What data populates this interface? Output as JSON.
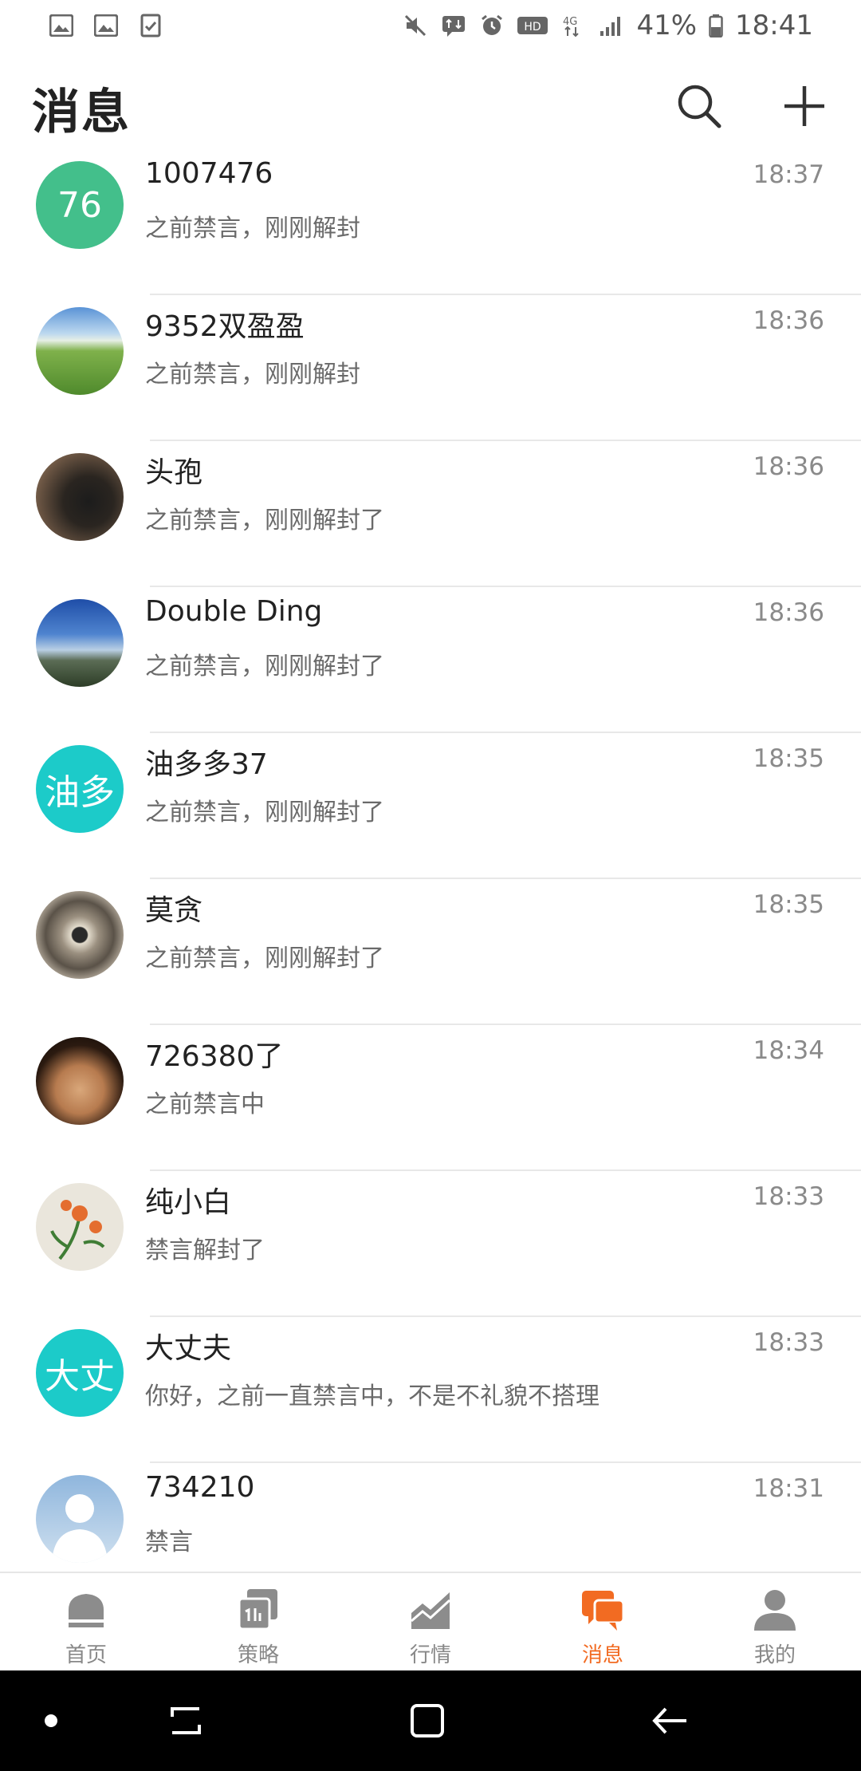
{
  "status_bar": {
    "left_icons": [
      "image-icon",
      "image-icon",
      "checklist-icon"
    ],
    "right_icons": [
      "mute-icon",
      "data-transfer-icon",
      "alarm-icon",
      "hd-icon",
      "network-4g-icon",
      "signal-icon"
    ],
    "battery": "41%",
    "time": "18:41"
  },
  "header": {
    "title": "消息",
    "search_icon": "search-icon",
    "add_icon": "plus-icon"
  },
  "conversations": [
    {
      "name": "1007476",
      "time": "18:37",
      "preview": "之前禁言，刚刚解封",
      "avatar_text": "76",
      "avatar_color": "#43bf8b"
    },
    {
      "name": "9352双盈盈",
      "time": "18:36",
      "preview": "之前禁言，刚刚解封",
      "avatar_text": "",
      "avatar_color": "#6fa24a"
    },
    {
      "name": "头孢",
      "time": "18:36",
      "preview": "之前禁言，刚刚解封了",
      "avatar_text": "",
      "avatar_color": "#4a3a32"
    },
    {
      "name": "Double Ding",
      "time": "18:36",
      "preview": "之前禁言，刚刚解封了",
      "avatar_text": "",
      "avatar_color": "#3c6fb0"
    },
    {
      "name": "油多多37",
      "time": "18:35",
      "preview": "之前禁言，刚刚解封了",
      "avatar_text": "油多",
      "avatar_color": "#1ccbc9"
    },
    {
      "name": "莫贪",
      "time": "18:35",
      "preview": "之前禁言，刚刚解封了",
      "avatar_text": "",
      "avatar_color": "#8c8478"
    },
    {
      "name": "726380了",
      "time": "18:34",
      "preview": "之前禁言中",
      "avatar_text": "",
      "avatar_color": "#2a1d12"
    },
    {
      "name": "纯小白",
      "time": "18:33",
      "preview": "禁言解封了",
      "avatar_text": "",
      "avatar_color": "#e7e3d9"
    },
    {
      "name": "大丈夫",
      "time": "18:33",
      "preview": "你好，之前一直禁言中，不是不礼貌不搭理",
      "avatar_text": "大丈",
      "avatar_color": "#1ccbc9"
    },
    {
      "name": "734210",
      "time": "18:31",
      "preview": "禁言",
      "avatar_text": "",
      "avatar_color": "#a9c7e4"
    }
  ],
  "tabs": [
    {
      "label": "首页",
      "icon": "home-icon",
      "active": false
    },
    {
      "label": "策略",
      "icon": "strategy-icon",
      "active": false
    },
    {
      "label": "行情",
      "icon": "chart-icon",
      "active": false
    },
    {
      "label": "消息",
      "icon": "chat-icon",
      "active": true
    },
    {
      "label": "我的",
      "icon": "profile-icon",
      "active": false
    }
  ],
  "nav_bar": {
    "buttons": [
      "dot-icon",
      "recent-apps-icon",
      "home-square-icon",
      "back-icon"
    ]
  },
  "colors": {
    "accent": "#f26b22",
    "tab_inactive": "#8c8c8c"
  }
}
